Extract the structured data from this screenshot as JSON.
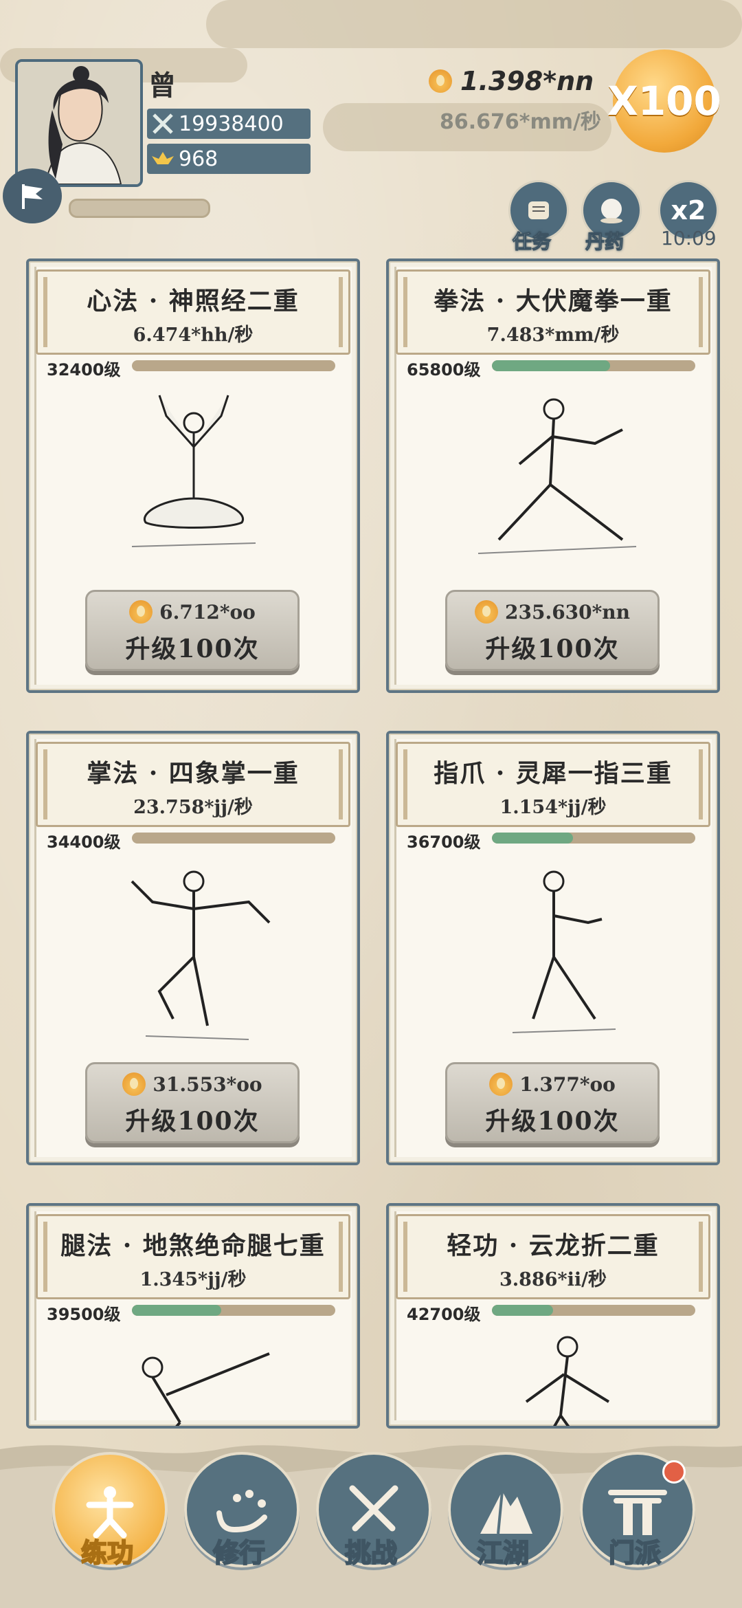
{
  "player": {
    "name": "曾",
    "power": "19938400",
    "ingots": "968"
  },
  "currency": {
    "amount": "1.398*nn",
    "rate": "86.676*mm/秒",
    "multiplier": "X100"
  },
  "side_buttons": [
    {
      "label": "任务",
      "icon": "scroll-icon"
    },
    {
      "label": "丹药",
      "icon": "pill-icon"
    },
    {
      "label": "x2",
      "icon": "double-icon"
    }
  ],
  "timer": "10:09",
  "cards": [
    {
      "name": "心法 · 神照经二重",
      "speed": "6.474*hh/秒",
      "level": "32400级",
      "progress": 0.0,
      "cost": "6.712*oo",
      "action": "升级100次"
    },
    {
      "name": "拳法 · 大伏魔拳一重",
      "speed": "7.483*mm/秒",
      "level": "65800级",
      "progress": 0.58,
      "cost": "235.630*nn",
      "action": "升级100次"
    },
    {
      "name": "掌法 · 四象掌一重",
      "speed": "23.758*jj/秒",
      "level": "34400级",
      "progress": 0.0,
      "cost": "31.553*oo",
      "action": "升级100次"
    },
    {
      "name": "指爪 · 灵犀一指三重",
      "speed": "1.154*jj/秒",
      "level": "36700级",
      "progress": 0.4,
      "cost": "1.377*oo",
      "action": "升级100次"
    },
    {
      "name": "腿法 · 地煞绝命腿七重",
      "speed": "1.345*jj/秒",
      "level": "39500级",
      "progress": 0.44,
      "cost": "",
      "action": ""
    },
    {
      "name": "轻功 · 云龙折二重",
      "speed": "3.886*ii/秒",
      "level": "42700级",
      "progress": 0.3,
      "cost": "",
      "action": ""
    }
  ],
  "nav": [
    {
      "label": "练功",
      "active": true
    },
    {
      "label": "修行",
      "active": false
    },
    {
      "label": "挑战",
      "active": false
    },
    {
      "label": "江湖",
      "active": false
    },
    {
      "label": "门派",
      "active": false
    }
  ],
  "colors": {
    "background": "#e7dcc6",
    "accent": "#56717f",
    "gold": "#f2a93b",
    "progress": "#6fa882"
  }
}
